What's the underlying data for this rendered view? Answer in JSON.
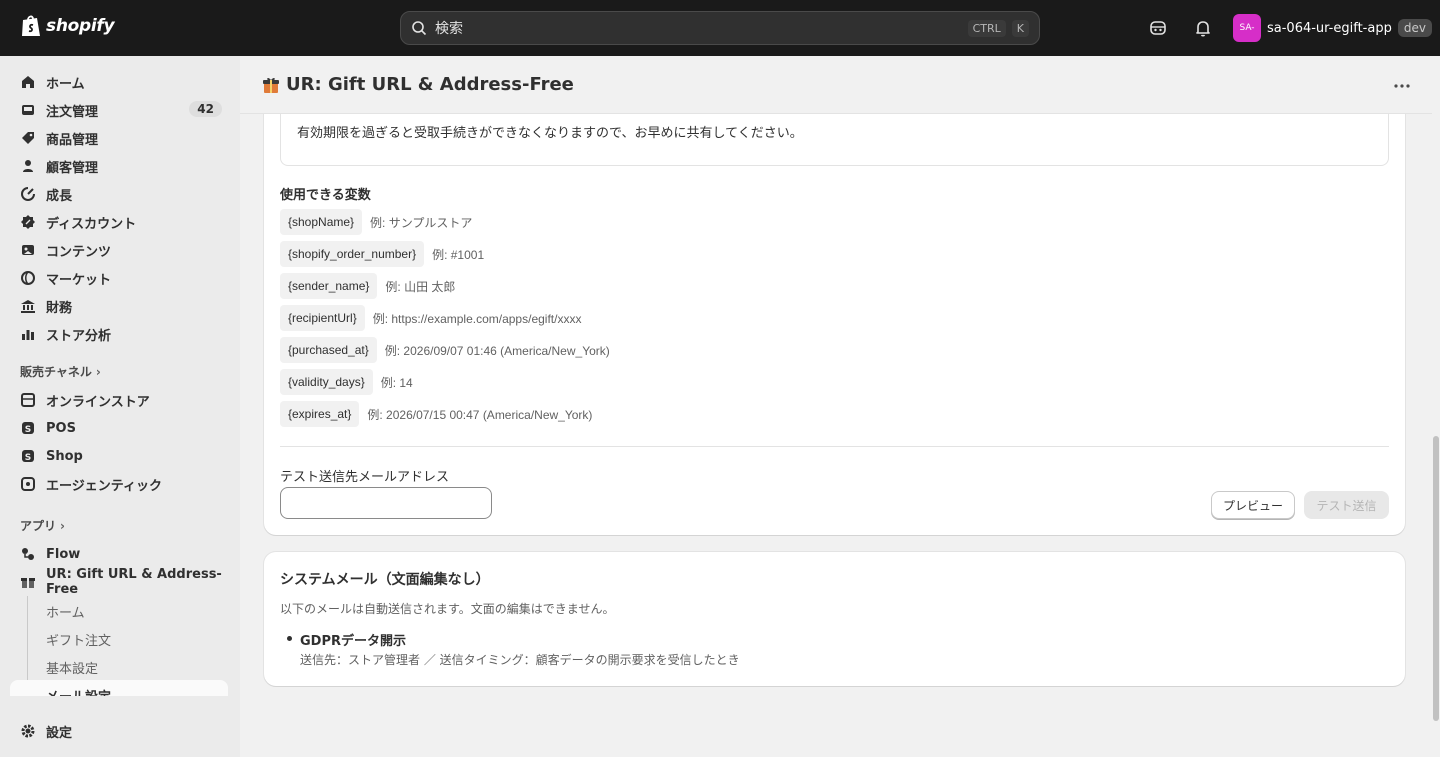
{
  "topbar": {
    "brand": "shopify",
    "search_placeholder": "検索",
    "kbd_ctrl": "CTRL",
    "kbd_k": "K",
    "avatar_initials": "SA-",
    "account_name": "sa-064-ur-egift-app",
    "env_badge": "dev"
  },
  "sidebar": {
    "items": [
      {
        "label": "ホーム",
        "icon": "home-icon"
      },
      {
        "label": "注文管理",
        "icon": "inbox-icon",
        "badge": "42"
      },
      {
        "label": "商品管理",
        "icon": "tag-icon"
      },
      {
        "label": "顧客管理",
        "icon": "person-icon"
      },
      {
        "label": "成長",
        "icon": "growth-icon"
      },
      {
        "label": "ディスカウント",
        "icon": "discount-icon"
      },
      {
        "label": "コンテンツ",
        "icon": "content-icon"
      },
      {
        "label": "マーケット",
        "icon": "globe-icon"
      },
      {
        "label": "財務",
        "icon": "bank-icon"
      },
      {
        "label": "ストア分析",
        "icon": "chart-icon"
      }
    ],
    "sales_channels_heading": "販売チャネル",
    "channels": [
      {
        "label": "オンラインストア",
        "icon": "store-icon"
      },
      {
        "label": "POS",
        "icon": "pos-icon"
      },
      {
        "label": "Shop",
        "icon": "shop-icon"
      },
      {
        "label": "エージェンティック",
        "icon": "agentic-icon"
      }
    ],
    "apps_heading": "アプリ",
    "apps": [
      {
        "label": "Flow",
        "icon": "flow-icon"
      },
      {
        "label": "UR: Gift URL & Address-Free",
        "icon": "gift-icon"
      }
    ],
    "app_subitems": [
      "ホーム",
      "ギフト注文",
      "基本設定",
      "メール設定"
    ],
    "settings_label": "設定"
  },
  "page": {
    "title": "UR: Gift URL & Address-Free"
  },
  "email_card": {
    "body_text": "有効期限を過ぎると受取手続きができなくなりますので、お早めに共有してください。",
    "vars_title": "使用できる変数",
    "variables": [
      {
        "name": "{shopName}",
        "example": "例: サンプルストア"
      },
      {
        "name": "{shopify_order_number}",
        "example": "例: #1001"
      },
      {
        "name": "{sender_name}",
        "example": "例: 山田 太郎"
      },
      {
        "name": "{recipientUrl}",
        "example": "例: https://example.com/apps/egift/xxxx"
      },
      {
        "name": "{purchased_at}",
        "example": "例: 2026/09/07 01:46 (America/New_York)"
      },
      {
        "name": "{validity_days}",
        "example": "例: 14"
      },
      {
        "name": "{expires_at}",
        "example": "例: 2026/07/15 00:47 (America/New_York)"
      }
    ],
    "test_email_label": "テスト送信先メールアドレス",
    "test_email_value": "",
    "preview_button": "プレビュー",
    "test_send_button": "テスト送信"
  },
  "system_card": {
    "title": "システムメール（文面編集なし）",
    "description": "以下のメールは自動送信されます。文面の編集はできません。",
    "items": [
      {
        "title": "GDPRデータ開示",
        "desc": "送信先：ストア管理者 ／ 送信タイミング：顧客データの開示要求を受信したとき"
      }
    ]
  }
}
